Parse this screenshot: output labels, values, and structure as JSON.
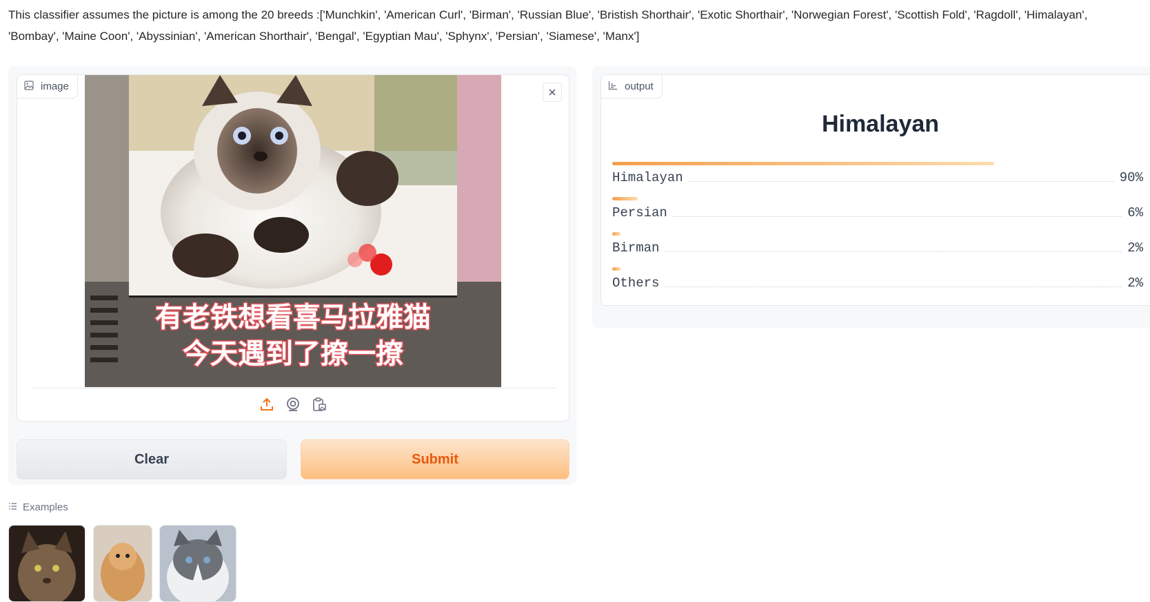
{
  "description": "This classifier assumes the picture is among the 20 breeds :['Munchkin', 'American Curl', 'Birman', 'Russian Blue', 'Bristish Shorthair', 'Exotic Shorthair', 'Norwegian Forest', 'Scottish Fold', 'Ragdoll', 'Himalayan', 'Bombay', 'Maine Coon', 'Abyssinian', 'American Shorthair', 'Bengal', 'Egyptian Mau', 'Sphynx', 'Persian', 'Siamese', 'Manx']",
  "input": {
    "label": "image",
    "label_icon": "image-icon",
    "caption_line1": "有老铁想看喜马拉雅猫",
    "caption_line2": "今天遇到了撩一撩",
    "source_icons": [
      "upload-icon",
      "webcam-icon",
      "clipboard-icon"
    ]
  },
  "buttons": {
    "clear": "Clear",
    "submit": "Submit"
  },
  "output": {
    "label": "output",
    "label_icon": "bar-chart-icon",
    "top_label": "Himalayan",
    "confidences": [
      {
        "label": "Himalayan",
        "value": 0.9,
        "display": "90%"
      },
      {
        "label": "Persian",
        "value": 0.06,
        "display": "6%"
      },
      {
        "label": "Birman",
        "value": 0.02,
        "display": "2%"
      },
      {
        "label": "Others",
        "value": 0.02,
        "display": "2%"
      }
    ]
  },
  "examples": {
    "label": "Examples",
    "icon": "list-icon"
  },
  "colors": {
    "accent": "#f97316",
    "submit_text": "#ea580c",
    "bar_start": "#f59e4b",
    "bar_end": "#fddcb0"
  }
}
